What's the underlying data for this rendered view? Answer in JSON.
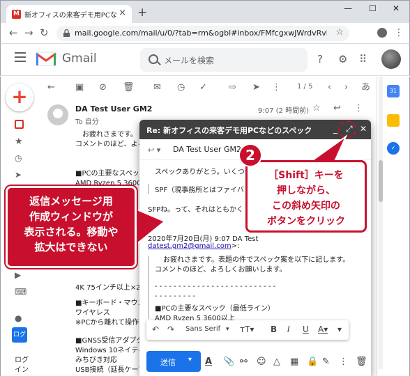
{
  "browser": {
    "tab_title": "新オフィスの来客デモ用PCなどのスペ",
    "tab_close": "×",
    "new_tab": "+",
    "window_minimize": "—",
    "window_maximize": "☐",
    "window_close": "✕",
    "url": "mail.google.com/mail/u/0/?tab=rm&ogbl#inbox/FMfcgxwJWrdvRvlSHBQBNDjnhFp..."
  },
  "gmail": {
    "logo_text": "Gmail",
    "search_placeholder": "メールを検索",
    "pager": "1 / 5",
    "lang_glyph": "あ"
  },
  "message": {
    "sender": "DA Test User GM2",
    "to": "To 自分",
    "date": "9:07 (2 時間前)",
    "body": [
      "お疲れさまです。",
      "コメントのほど、よろ",
      "",
      "■PCの主要なスペック",
      "AMD Ryzen 5 3600以",
      "",
      "",
      "",
      "",
      "",
      "4K 75インチ以上×2台",
      "",
      "■キーボード・マウス",
      "ワイヤレス",
      "※PCから離れて操作",
      "",
      "■GNSS受信アダプタ",
      "Windows 10ネイティ",
      "みちびき対応",
      "USB接続（延長ケーブ"
    ]
  },
  "rail": {
    "bottom_text_1": "ログ",
    "bottom_text_2": "イン",
    "badge_text": "ログ",
    "calendar_label": "31"
  },
  "reply_popup": {
    "title": "Re: 新オフィスの来客デモ用PCなどのスペック",
    "to": "DA Test User GM2",
    "lines": [
      "スペックありがとう。いくつか",
      "",
      "SPF（現事務所とはファイバ",
      "",
      "SFPね。って、それはともかく"
    ],
    "quote_header": "2020年7月20日(月) 9:07 DA Test",
    "quote_email": "datest.gm2@gmail.com",
    "quote_email_suffix": ">:",
    "quote_lines": [
      "お疲れさまです。表題の件でスペック案を以下に記します。",
      "コメントのほど、よろしくお願いします。",
      "",
      "- - - - - - - - - - - - - - - - - - - - - - - - - -",
      "- - - - - - - - -",
      "■PCの主要なスペック（最低ライン）",
      "AMD Ryzen 5 3600以上"
    ],
    "font_name": "Sans Serif",
    "send_label": "送信"
  },
  "annotations": {
    "left_callout": "返信メッセージ用\n作成ウィンドウが\n表示される。移動や\n拡大はできない",
    "step_number": "2",
    "right_callout": "［Shift］キーを\n押しながら、\nこの斜め矢印の\nボタンをクリック"
  },
  "colors": {
    "annotation_red": "#c8102e",
    "popup_header": "#404040",
    "send_blue": "#1a73e8"
  }
}
